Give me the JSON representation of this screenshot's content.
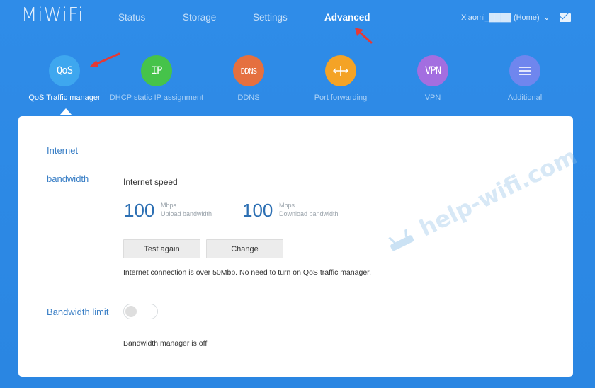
{
  "header": {
    "logo": "MiWiFi",
    "nav": [
      "Status",
      "Storage",
      "Settings",
      "Advanced"
    ],
    "active_nav": "Advanced",
    "user": "Xiaomi_████ (Home)"
  },
  "features": [
    {
      "icon_text": "QoS",
      "label": "QoS Traffic manager",
      "color": "#3ea7ef",
      "icon": "qos-icon"
    },
    {
      "icon_text": "IP",
      "label": "DHCP static IP assignment",
      "color": "#46c34a",
      "icon": "ip-icon"
    },
    {
      "icon_text": "DDNS",
      "label": "DDNS",
      "color": "#e5703f",
      "icon": "ddns-icon"
    },
    {
      "icon_text": "",
      "label": "Port forwarding",
      "color": "#f4a326",
      "icon": "port-forwarding-icon"
    },
    {
      "icon_text": "VPN",
      "label": "VPN",
      "color": "#a36ee0",
      "icon": "vpn-icon"
    },
    {
      "icon_text": "",
      "label": "Additional",
      "color": "#6f86ee",
      "icon": "menu-icon"
    }
  ],
  "panel": {
    "section_internet": "Internet",
    "bandwidth_label": "bandwidth",
    "internet_speed_title": "Internet speed",
    "upload": {
      "value": "100",
      "unit": "Mbps",
      "caption": "Upload bandwidth"
    },
    "download": {
      "value": "100",
      "unit": "Mbps",
      "caption": "Download bandwidth"
    },
    "test_again": "Test again",
    "change": "Change",
    "info_text": "Internet connection is over 50Mbp. No need to turn on QoS traffic manager.",
    "bandwidth_limit_label": "Bandwidth limit",
    "bandwidth_limit_on": false,
    "manager_status": "Bandwidth manager is off"
  },
  "watermark": "help-wifi.com",
  "colors": {
    "background": "#2e8ae6",
    "accent_text": "#3a7fc6",
    "annotation_arrow": "#e53935"
  }
}
